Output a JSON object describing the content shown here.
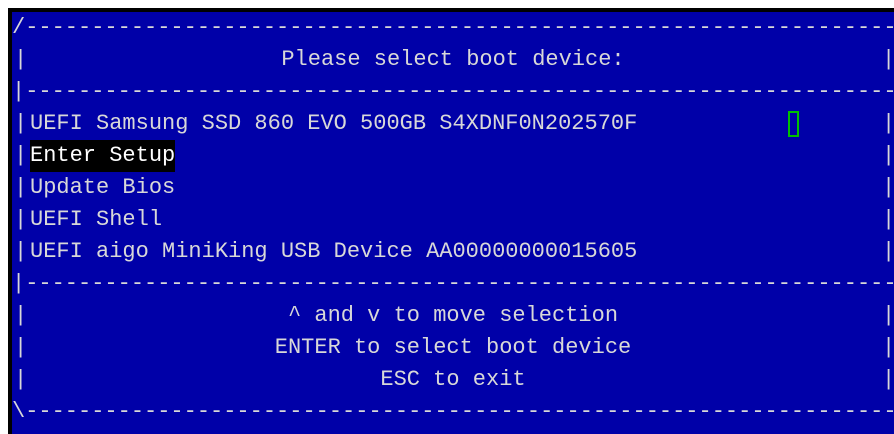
{
  "title": "Please select boot device:",
  "menu": {
    "items": [
      {
        "label": "UEFI Samsung SSD 860 EVO 500GB S4XDNF0N202570F"
      },
      {
        "label": "Enter Setup"
      },
      {
        "label": "Update Bios"
      },
      {
        "label": "UEFI Shell"
      },
      {
        "label": "UEFI aigo MiniKing USB Device AA00000000015605"
      }
    ],
    "selected_index": 1
  },
  "help": {
    "line1": "^ and v to move selection",
    "line2": "ENTER to select boot device",
    "line3": "ESC to exit"
  },
  "borders": {
    "top": "/-------------------------------------------------------------------------\\",
    "separator": "|-------------------------------------------------------------------------|",
    "bottom": "\\-------------------------------------------------------------------------/",
    "vertical": "|"
  },
  "colors": {
    "background": "#0000a8",
    "text": "#d8d8d8",
    "selected_bg": "#000000",
    "selected_text": "#ffffff",
    "cursor": "#00c000"
  }
}
